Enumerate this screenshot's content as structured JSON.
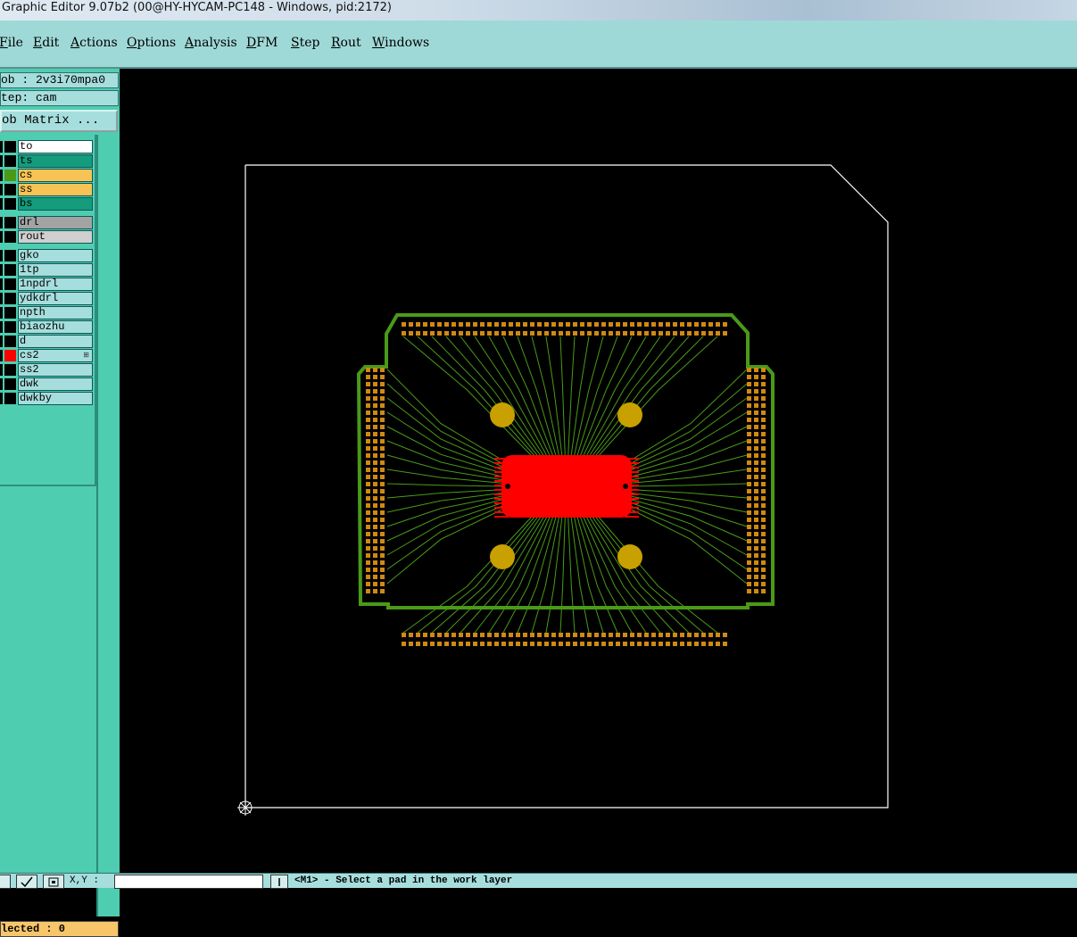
{
  "window": {
    "title": "Graphic Editor 9.07b2 (00@HY-HYCAM-PC148 - Windows, pid:2172)"
  },
  "menu": [
    "File",
    "Edit",
    "Actions",
    "Options",
    "Analysis",
    "DFM",
    "Step",
    "Rout",
    "Windows"
  ],
  "job": {
    "job_label": "ob : 2v3i70mpa0",
    "step_label": "tep: cam",
    "matrix_button": "ob Matrix ..."
  },
  "layers": {
    "board": [
      {
        "name": "to",
        "fill": "#ffffff",
        "swatch": "#000000"
      },
      {
        "name": "ts",
        "fill": "#149c7c",
        "swatch": "#000000"
      },
      {
        "name": "cs",
        "fill": "#f7c354",
        "swatch": "#4a9a18"
      },
      {
        "name": "ss",
        "fill": "#f7c354",
        "swatch": "#000000"
      },
      {
        "name": "bs",
        "fill": "#149c7c",
        "swatch": "#000000"
      }
    ],
    "drill": [
      {
        "name": "drl",
        "fill": "#a3a3a3",
        "swatch": "#000000"
      },
      {
        "name": "rout",
        "fill": "#cfcfcf",
        "swatch": "#000000"
      }
    ],
    "misc": [
      {
        "name": "gko",
        "fill": "#a6dedd",
        "swatch": "#000000"
      },
      {
        "name": "1tp",
        "fill": "#a6dedd",
        "swatch": "#000000"
      },
      {
        "name": "1npdrl",
        "fill": "#a6dedd",
        "swatch": "#000000"
      },
      {
        "name": "ydkdrl",
        "fill": "#a6dedd",
        "swatch": "#000000"
      },
      {
        "name": "npth",
        "fill": "#a6dedd",
        "swatch": "#000000"
      },
      {
        "name": "biaozhu",
        "fill": "#a6dedd",
        "swatch": "#000000"
      },
      {
        "name": "d",
        "fill": "#a6dedd",
        "swatch": "#000000"
      },
      {
        "name": "cs2",
        "fill": "#a6dedd",
        "swatch": "#ff0000",
        "marker": "⊞"
      },
      {
        "name": "ss2",
        "fill": "#a6dedd",
        "swatch": "#000000"
      },
      {
        "name": "dwk",
        "fill": "#a6dedd",
        "swatch": "#000000"
      },
      {
        "name": "dwkby",
        "fill": "#a6dedd",
        "swatch": "#000000"
      }
    ]
  },
  "selected_label": "lected : 0",
  "statusbar": {
    "coord_label": "X,Y :",
    "prompt": "<M1> - Select a pad in the work layer"
  },
  "colors": {
    "trace": "#4a9a18",
    "pad": "#d08a10",
    "work_red": "#ff0000",
    "mounting_hole": "#c8a000",
    "outline": "#ffffff"
  }
}
